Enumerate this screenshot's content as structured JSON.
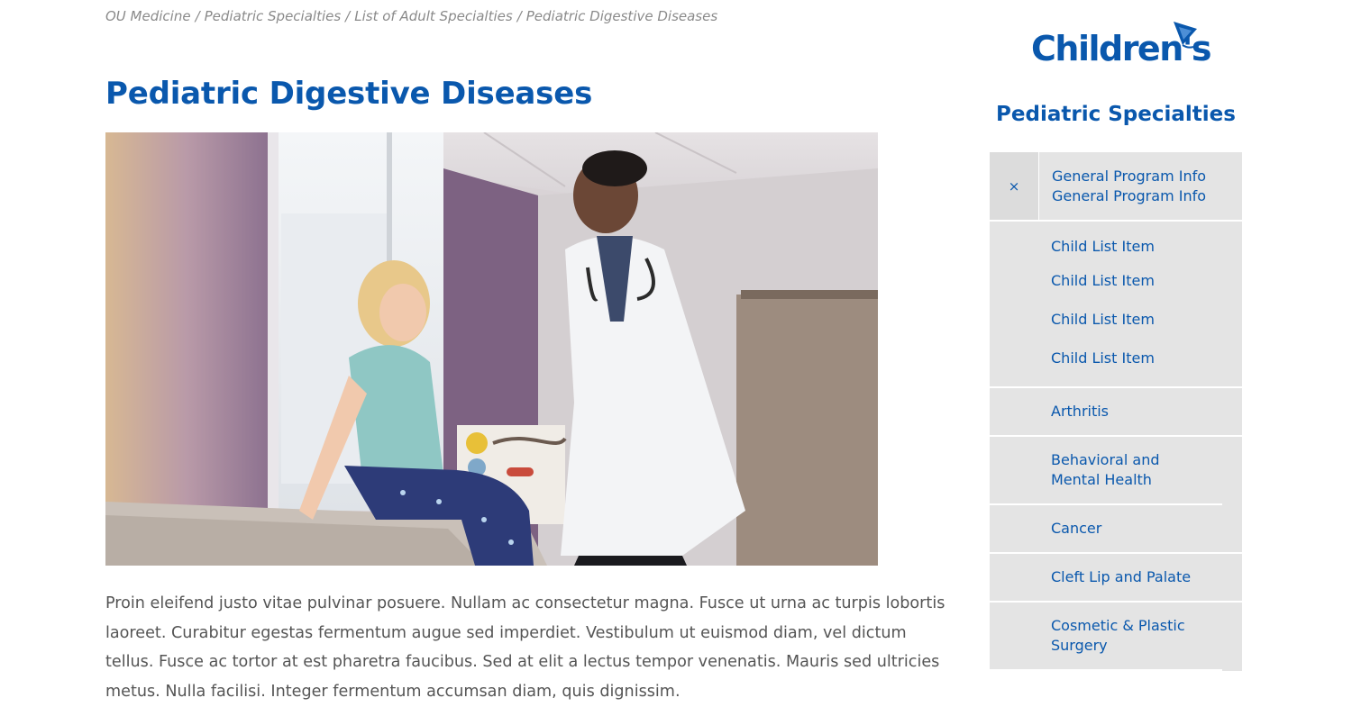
{
  "breadcrumb": {
    "items": [
      "OU Medicine",
      "Pediatric Specialties",
      "List of Adult Specialties",
      "Pediatric Digestive Diseases"
    ],
    "separator": "/"
  },
  "page": {
    "title": "Pediatric Digestive Diseases",
    "body": "Proin eleifend justo vitae pulvinar posuere. Nullam ac consectetur magna. Fusce ut urna ac turpis lobortis laoreet. Curabitur egestas fermentum augue sed imperdiet. Vestibulum ut euismod diam, vel dictum tellus. Fusce ac tortor at est pharetra faucibus. Sed at elit a lectus tempor venenatis. Mauris sed ultricies metus. Nulla facilisi. Integer fermentum accumsan diam, quis dignissim."
  },
  "sidebar": {
    "logo_text": "Children's",
    "heading": "Pediatric Specialties",
    "group": {
      "toggle_icon": "close-icon",
      "toggle_glyph": "×",
      "title_line1": "General Program Info",
      "title_line2": "General Program Info",
      "children": [
        "Child List Item",
        "Child List Item",
        "Child List Item",
        "Child List Item"
      ]
    },
    "items": [
      "Arthritis",
      "Behavioral and Mental Health",
      "Cancer",
      "Cleft Lip and Palate",
      "Cosmetic & Plastic Surgery"
    ]
  },
  "colors": {
    "brand_blue": "#0a58ad",
    "nav_bg": "#e4e4e4",
    "body_text": "#555555",
    "breadcrumb": "#8a8a8a"
  }
}
